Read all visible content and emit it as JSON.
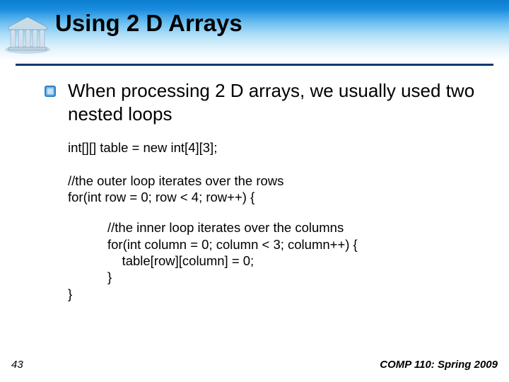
{
  "slide": {
    "title": "Using 2 D Arrays",
    "bullet_text": "When processing 2 D arrays, we usually used two nested loops",
    "code": {
      "decl": "int[][] table = new int[4][3];",
      "outer_comment": "//the outer loop iterates over the rows",
      "outer_for": "for(int row = 0; row < 4; row++) {",
      "inner_comment": "//the inner loop iterates over the columns",
      "inner_for": "for(int column = 0; column < 3; column++) {",
      "inner_body": "    table[row][column] = 0;",
      "inner_close": "}",
      "outer_close": "}"
    },
    "number": "43",
    "footer": "COMP 110: Spring 2009"
  }
}
